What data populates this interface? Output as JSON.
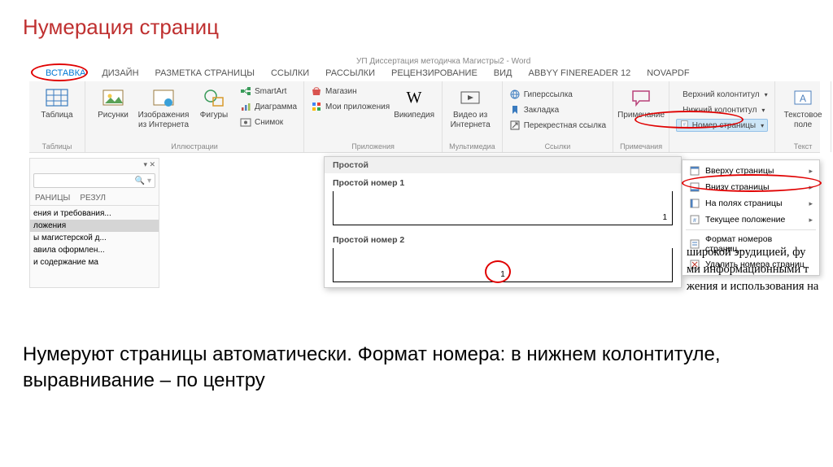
{
  "slide": {
    "title": "Нумерация страниц",
    "caption": "Нумеруют страницы автоматически. Формат номера: в нижнем колонтитуле, выравнивание – по центру"
  },
  "window_title": "УП Диссертация методичка Магистры2 - Word",
  "tabs": [
    "ВСТАВКА",
    "ДИЗАЙН",
    "РАЗМЕТКА СТРАНИЦЫ",
    "ССЫЛКИ",
    "РАССЫЛКИ",
    "РЕЦЕНЗИРОВАНИЕ",
    "ВИД",
    "ABBYY FineReader 12",
    "novaPDF"
  ],
  "ribbon": {
    "tables": {
      "label": "Таблицы",
      "table": "Таблица"
    },
    "illustrations": {
      "label": "Иллюстрации",
      "pictures": "Рисунки",
      "online": "Изображения из Интернета",
      "shapes": "Фигуры",
      "smartart": "SmartArt",
      "chart": "Диаграмма",
      "screenshot": "Снимок"
    },
    "apps": {
      "label": "Приложения",
      "store": "Магазин",
      "myapps": "Мои приложения",
      "wiki": "Википедия"
    },
    "media": {
      "label": "Мультимедиа",
      "video": "Видео из Интернета"
    },
    "links": {
      "label": "Ссылки",
      "hyperlink": "Гиперссылка",
      "bookmark": "Закладка",
      "crossref": "Перекрестная ссылка"
    },
    "comments": {
      "label": "Примечания",
      "comment": "Примечание"
    },
    "hf": {
      "header": "Верхний колонтитул",
      "footer": "Нижний колонтитул",
      "pagenum": "Номер страницы"
    },
    "text": {
      "label": "Текст",
      "textbox": "Текстовое поле"
    }
  },
  "pagenum_menu": {
    "top": "Вверху страницы",
    "bottom": "Внизу страницы",
    "margins": "На полях страницы",
    "current": "Текущее положение",
    "format": "Формат номеров страниц...",
    "remove": "Удалить номера страниц"
  },
  "gallery": {
    "header": "Простой",
    "item1": "Простой номер 1",
    "item2": "Простой номер 2",
    "num": "1"
  },
  "nav": {
    "tabs": [
      "РАНИЦЫ",
      "РЕЗУЛ"
    ],
    "items": [
      "ения и требования...",
      "ложения",
      "ы магистерской д...",
      "авила оформлен...",
      "и содержание ма"
    ]
  },
  "doc_text": {
    "l1": "широкой эрудицией, фу",
    "l2": "ми информационными т",
    "l3": "жения и использования на"
  }
}
